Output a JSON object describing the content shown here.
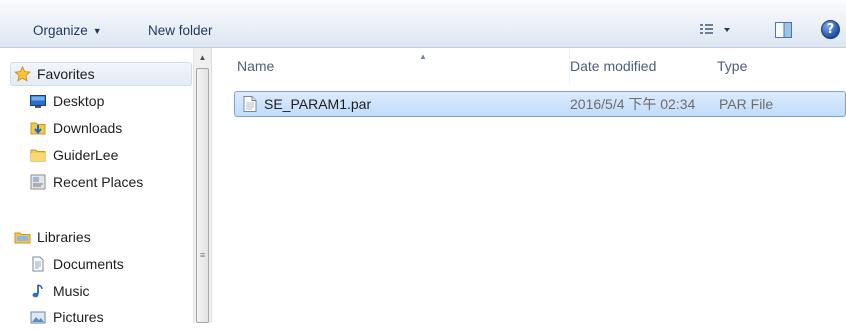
{
  "toolbar": {
    "organize_label": "Organize",
    "new_folder_label": "New folder",
    "help_glyph": "?"
  },
  "navigation": {
    "favorites": {
      "label": "Favorites",
      "icon": "star-icon",
      "items": [
        {
          "label": "Desktop",
          "icon": "desktop-icon"
        },
        {
          "label": "Downloads",
          "icon": "downloads-folder-icon"
        },
        {
          "label": "GuiderLee",
          "icon": "folder-icon"
        },
        {
          "label": "Recent Places",
          "icon": "recent-places-icon"
        }
      ]
    },
    "libraries": {
      "label": "Libraries",
      "icon": "libraries-icon",
      "items": [
        {
          "label": "Documents",
          "icon": "documents-icon"
        },
        {
          "label": "Music",
          "icon": "music-icon"
        },
        {
          "label": "Pictures",
          "icon": "pictures-icon"
        }
      ]
    }
  },
  "file_list": {
    "columns": [
      "Name",
      "Date modified",
      "Type"
    ],
    "sort_column": "Name",
    "rows": [
      {
        "name": "SE_PARAM1.par",
        "date_modified": "2016/5/4 下午 02:34",
        "type": "PAR File",
        "icon": "document-file-icon",
        "selected": true
      }
    ]
  },
  "colors": {
    "toolbar_text": "#1e395b",
    "selection_fill": "#c1dcfc",
    "selection_border": "#7da2ce",
    "header_text": "#4c607a"
  }
}
